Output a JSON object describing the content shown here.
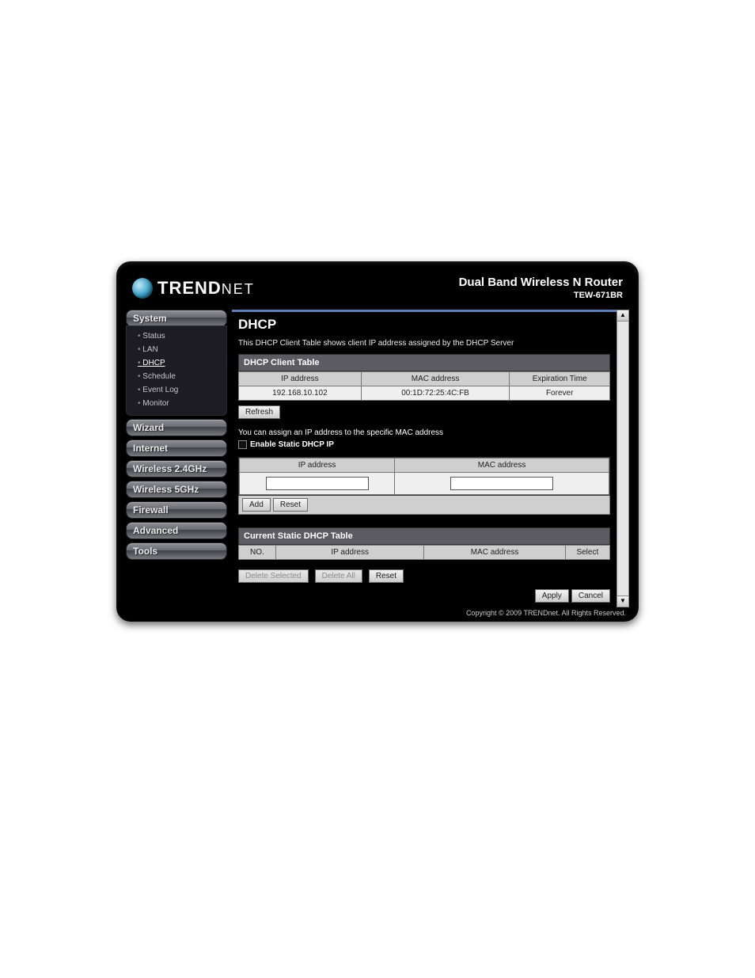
{
  "brand": {
    "name": "TRENDNET",
    "prefix": "TREND",
    "suffix": "NET"
  },
  "product": {
    "title": "Dual Band Wireless N Router",
    "model": "TEW-671BR"
  },
  "nav": {
    "sections": [
      {
        "label": "System"
      },
      {
        "label": "Wizard"
      },
      {
        "label": "Internet"
      },
      {
        "label": "Wireless 2.4GHz"
      },
      {
        "label": "Wireless 5GHz"
      },
      {
        "label": "Firewall"
      },
      {
        "label": "Advanced"
      },
      {
        "label": "Tools"
      }
    ],
    "system_items": [
      {
        "label": "Status"
      },
      {
        "label": "LAN"
      },
      {
        "label": "DHCP"
      },
      {
        "label": "Schedule"
      },
      {
        "label": "Event Log"
      },
      {
        "label": "Monitor"
      }
    ]
  },
  "page": {
    "title": "DHCP",
    "description": "This DHCP Client Table shows client IP address assigned by the DHCP Server",
    "client_table_title": "DHCP Client Table",
    "headers": {
      "ip": "IP address",
      "mac": "MAC address",
      "expire": "Expiration Time"
    },
    "clients": [
      {
        "ip": "192.168.10.102",
        "mac": "00:1D:72:25:4C:FB",
        "expire": "Forever"
      }
    ],
    "refresh": "Refresh",
    "assign_note": "You can assign an IP address to the specific MAC address",
    "enable_static_label": "Enable Static DHCP IP",
    "entry_headers": {
      "ip": "IP address",
      "mac": "MAC address"
    },
    "add": "Add",
    "reset": "Reset",
    "static_title": "Current Static DHCP Table",
    "static_headers": {
      "no": "NO.",
      "ip": "IP address",
      "mac": "MAC address",
      "select": "Select"
    },
    "delete_selected": "Delete Selected",
    "delete_all": "Delete All",
    "reset2": "Reset",
    "apply": "Apply",
    "cancel": "Cancel"
  },
  "footer": {
    "copyright": "Copyright © 2009 TRENDnet. All Rights Reserved."
  }
}
